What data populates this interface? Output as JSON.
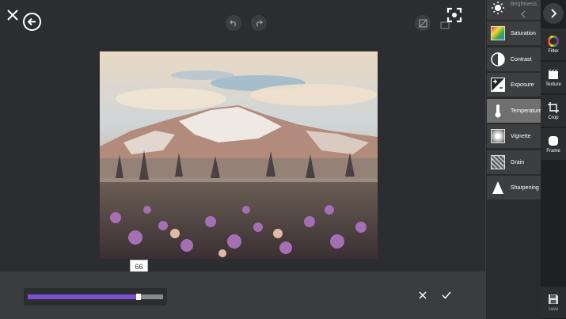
{
  "slider": {
    "value_label": "66",
    "fraction": 0.82,
    "fill_color": "#7b4fd6"
  },
  "tools": [
    {
      "label": "Brightness",
      "icon": "brightness-icon"
    },
    {
      "label": "Saturation",
      "icon": "saturation-icon"
    },
    {
      "label": "Contrast",
      "icon": "contrast-icon"
    },
    {
      "label": "Exposure",
      "icon": "exposure-icon"
    },
    {
      "label": "Temperature",
      "icon": "temperature-icon",
      "active": true
    },
    {
      "label": "Vignette",
      "icon": "vignette-icon"
    },
    {
      "label": "Grain",
      "icon": "grain-icon"
    },
    {
      "label": "Sharpening",
      "icon": "sharpening-icon"
    }
  ],
  "rail": [
    {
      "label": "Filter",
      "icon": "filter-icon"
    },
    {
      "label": "Texture",
      "icon": "texture-icon"
    },
    {
      "label": "Crop",
      "icon": "crop-icon"
    },
    {
      "label": "Frame",
      "icon": "frame-icon"
    },
    {
      "label": "save",
      "icon": "save-icon"
    }
  ]
}
